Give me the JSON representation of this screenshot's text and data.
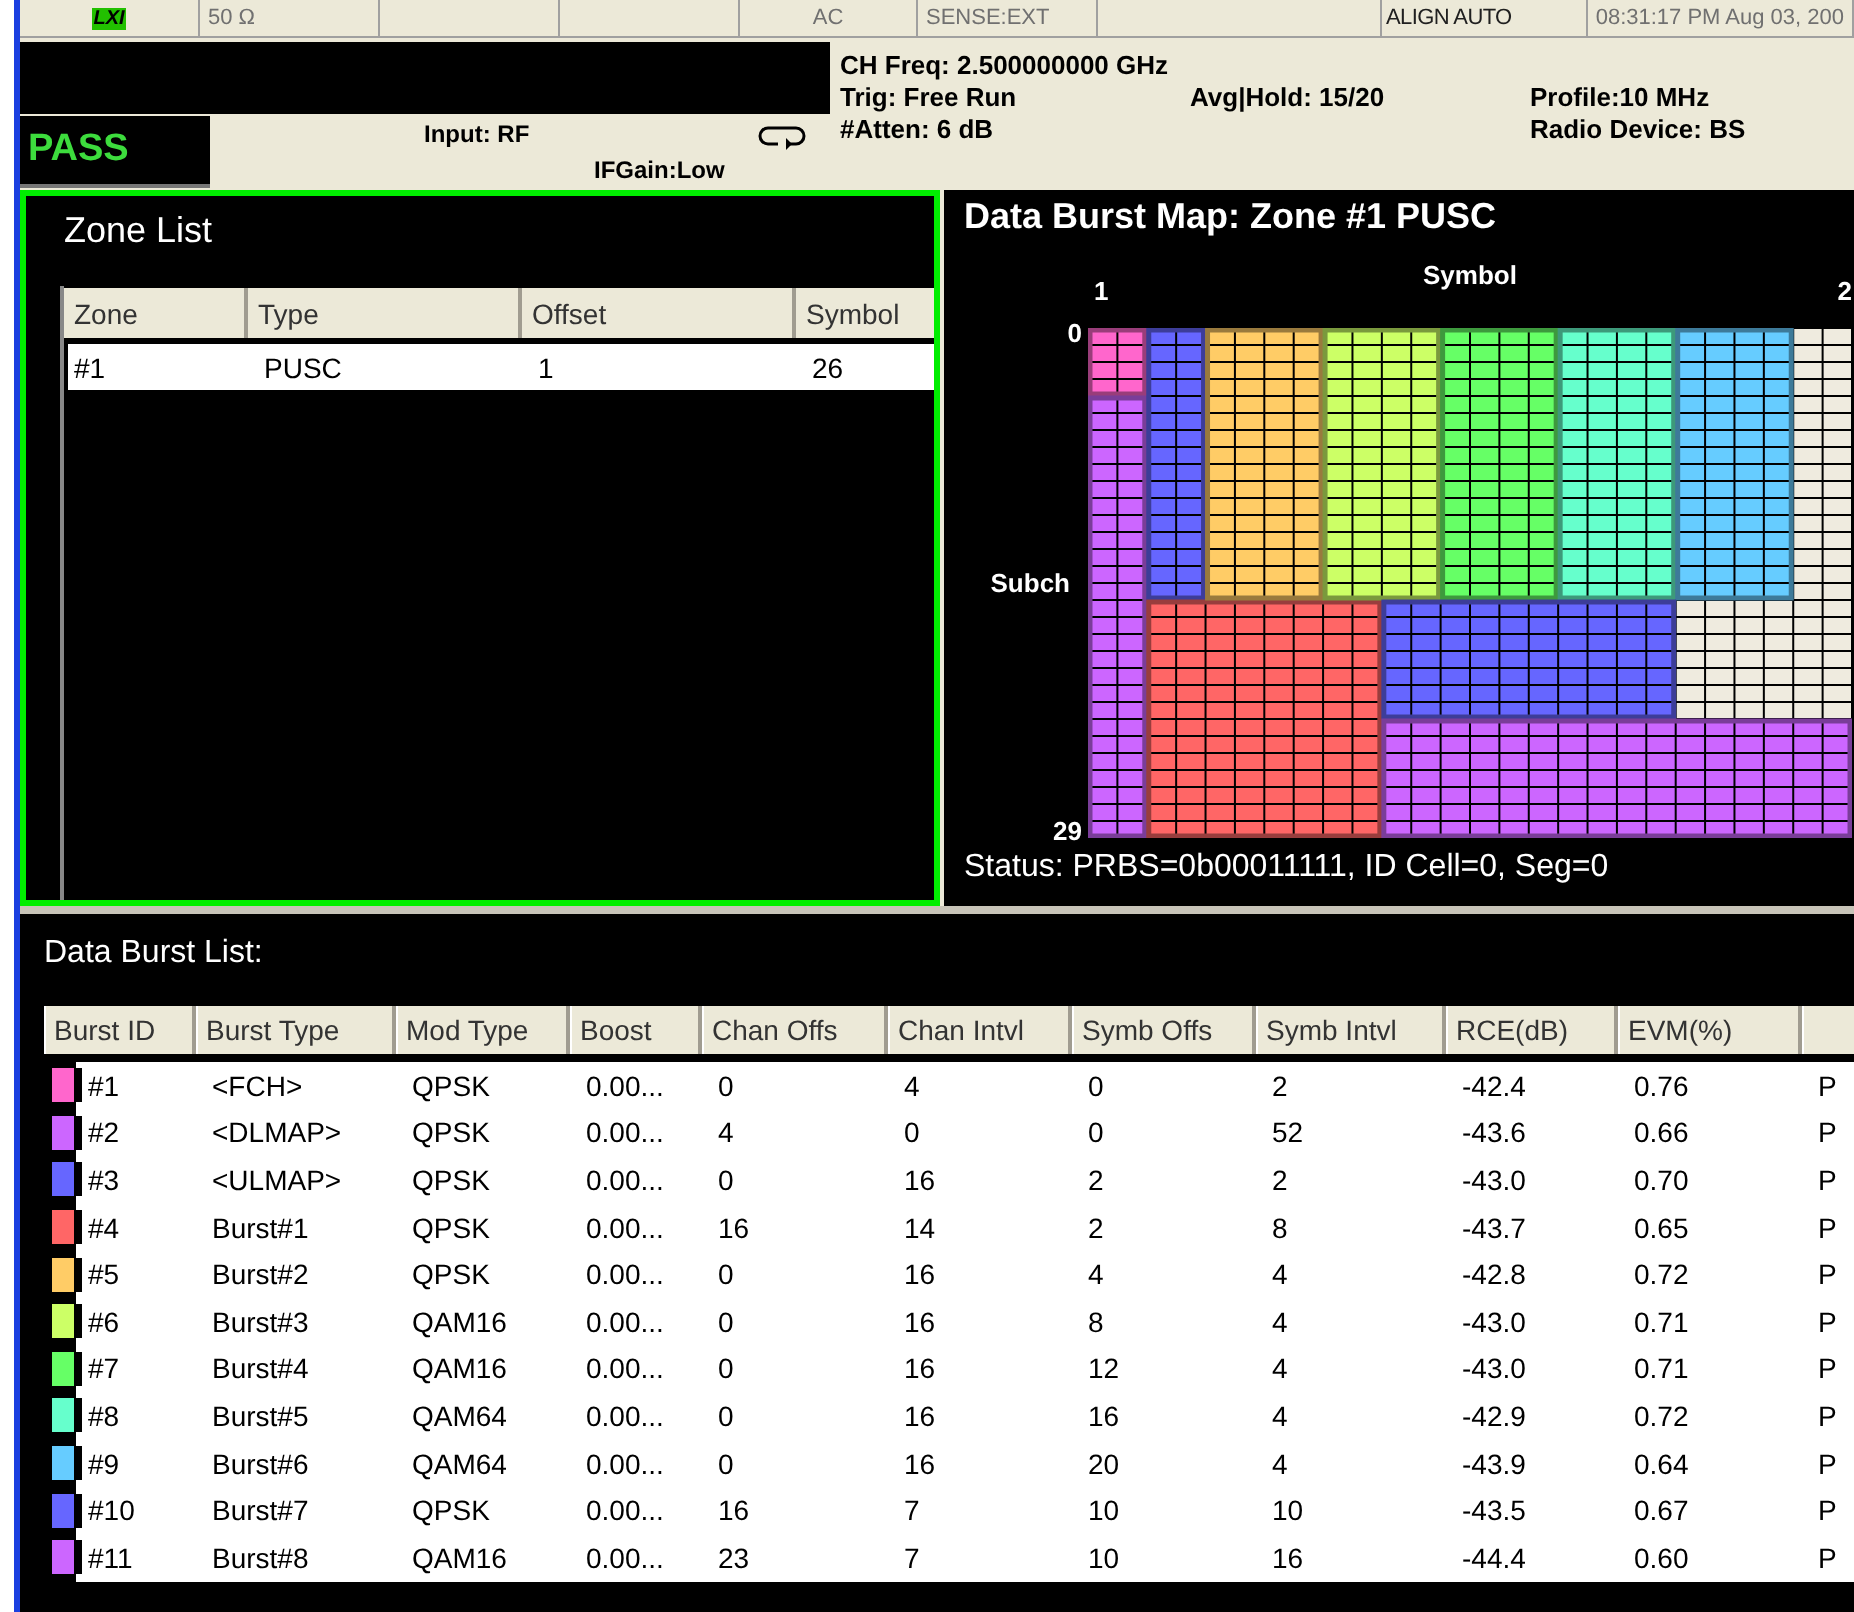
{
  "status_bar": {
    "cells": [
      {
        "kind": "logo",
        "text": "LXI"
      },
      {
        "kind": "text",
        "text": "50 Ω"
      },
      {
        "kind": "blank"
      },
      {
        "kind": "blank"
      },
      {
        "kind": "text",
        "text": "AC"
      },
      {
        "kind": "text",
        "text": "SENSE:EXT"
      },
      {
        "kind": "blank"
      },
      {
        "kind": "text",
        "text": "ALIGN AUTO"
      },
      {
        "kind": "text",
        "text": "08:31:17 PM Aug 03, 200"
      }
    ]
  },
  "header": {
    "result": "PASS",
    "input": "Input: RF",
    "if_gain": "IFGain:Low",
    "ch_freq": "CH Freq: 2.500000000 GHz",
    "trigger": "Trig: Free Run",
    "atten": "#Atten: 6 dB",
    "avg_hold": "Avg|Hold: 15/20",
    "profile": "Profile:10 MHz",
    "radio_device": "Radio Device: BS"
  },
  "zone_list": {
    "title": "Zone List",
    "active": true,
    "columns": [
      "Zone",
      "Type",
      "Offset",
      "Symbol"
    ],
    "rows": [
      [
        "#1",
        "PUSC",
        "1",
        "26"
      ]
    ]
  },
  "burst_map": {
    "title": "Data Burst Map: Zone #1 PUSC",
    "x_label": "Symbol",
    "x_first": "1",
    "x_last": "2",
    "y_label": "Subch",
    "y_first": "0",
    "y_last": "29",
    "status": "Status: PRBS=0b00011111, ID Cell=0, Seg=0"
  },
  "burst_list": {
    "title": "Data Burst List:",
    "columns": [
      "Burst ID",
      "Burst Type",
      "Mod Type",
      "Boost",
      "Chan Offs",
      "Chan Intvl",
      "Symb Offs",
      "Symb Intvl",
      "RCE(dB)",
      "EVM(%)"
    ],
    "rows": [
      {
        "color": "#ff66cc",
        "cells": [
          "#1",
          "<FCH>",
          "QPSK",
          "0.00...",
          "0",
          "4",
          "0",
          "2",
          "-42.4",
          "0.76",
          "P"
        ]
      },
      {
        "color": "#cc66ff",
        "cells": [
          "#2",
          "<DLMAP>",
          "QPSK",
          "0.00...",
          "4",
          "0",
          "0",
          "52",
          "-43.6",
          "0.66",
          "P"
        ]
      },
      {
        "color": "#6666ff",
        "cells": [
          "#3",
          "<ULMAP>",
          "QPSK",
          "0.00...",
          "0",
          "16",
          "2",
          "2",
          "-43.0",
          "0.70",
          "P"
        ]
      },
      {
        "color": "#ff6666",
        "cells": [
          "#4",
          "Burst#1",
          "QPSK",
          "0.00...",
          "16",
          "14",
          "2",
          "8",
          "-43.7",
          "0.65",
          "P"
        ]
      },
      {
        "color": "#ffcc66",
        "cells": [
          "#5",
          "Burst#2",
          "QPSK",
          "0.00...",
          "0",
          "16",
          "4",
          "4",
          "-42.8",
          "0.72",
          "P"
        ]
      },
      {
        "color": "#ccff66",
        "cells": [
          "#6",
          "Burst#3",
          "QAM16",
          "0.00...",
          "0",
          "16",
          "8",
          "4",
          "-43.0",
          "0.71",
          "P"
        ]
      },
      {
        "color": "#66ff66",
        "cells": [
          "#7",
          "Burst#4",
          "QAM16",
          "0.00...",
          "0",
          "16",
          "12",
          "4",
          "-43.0",
          "0.71",
          "P"
        ]
      },
      {
        "color": "#66ffcc",
        "cells": [
          "#8",
          "Burst#5",
          "QAM64",
          "0.00...",
          "0",
          "16",
          "16",
          "4",
          "-42.9",
          "0.72",
          "P"
        ]
      },
      {
        "color": "#66ccff",
        "cells": [
          "#9",
          "Burst#6",
          "QAM64",
          "0.00...",
          "0",
          "16",
          "20",
          "4",
          "-43.9",
          "0.64",
          "P"
        ]
      },
      {
        "color": "#6666ff",
        "cells": [
          "#10",
          "Burst#7",
          "QPSK",
          "0.00...",
          "16",
          "7",
          "10",
          "10",
          "-43.5",
          "0.67",
          "P"
        ]
      },
      {
        "color": "#cc66ff",
        "cells": [
          "#11",
          "Burst#8",
          "QAM16",
          "0.00...",
          "23",
          "7",
          "10",
          "16",
          "-44.4",
          "0.60",
          "P"
        ]
      }
    ]
  }
}
